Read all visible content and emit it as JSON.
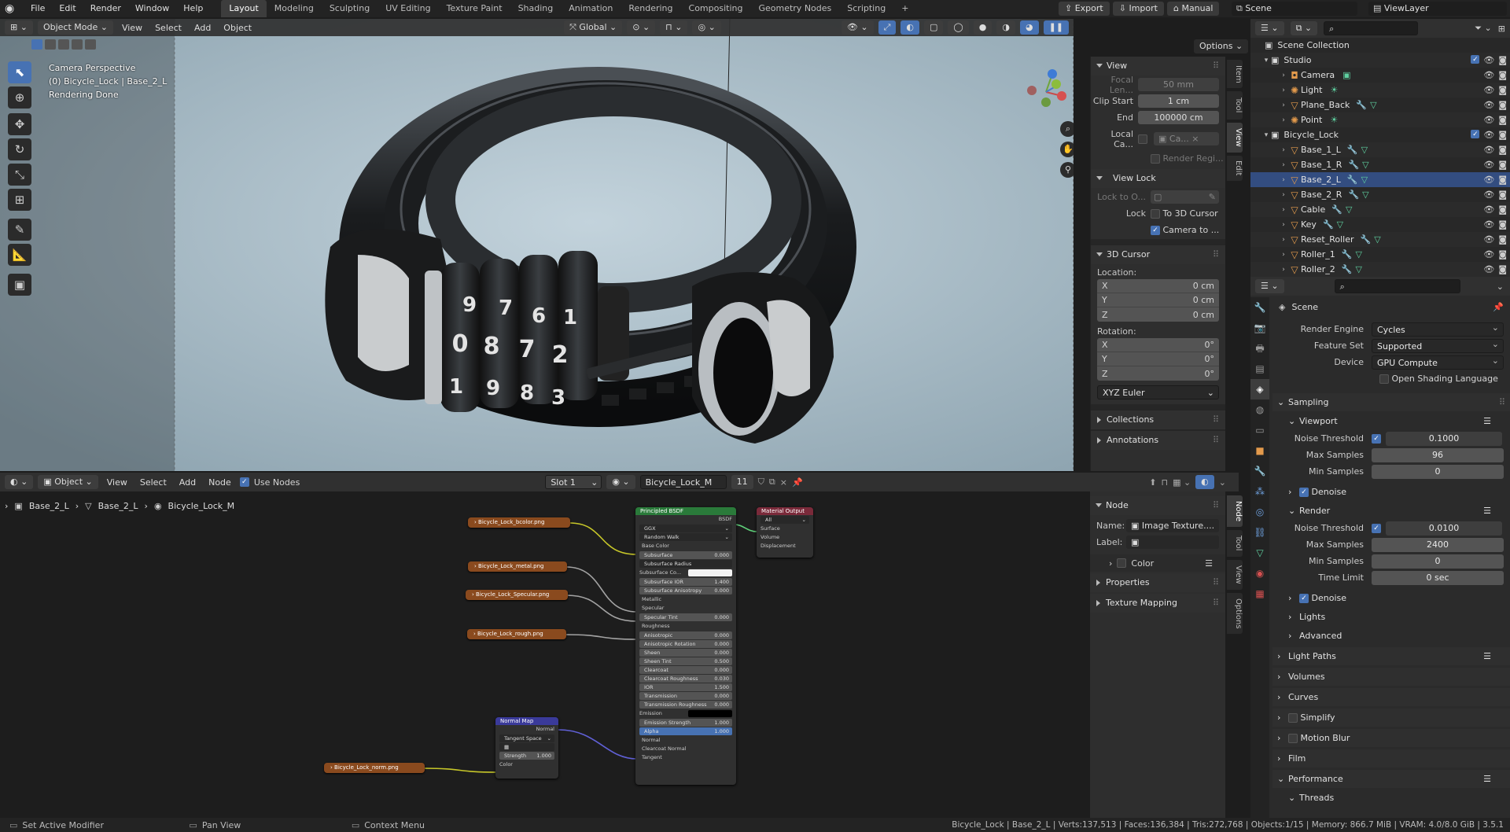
{
  "topbar": {
    "menus": [
      "File",
      "Edit",
      "Render",
      "Window",
      "Help"
    ],
    "workspaces": [
      "Layout",
      "Modeling",
      "Sculpting",
      "UV Editing",
      "Texture Paint",
      "Shading",
      "Animation",
      "Rendering",
      "Compositing",
      "Geometry Nodes",
      "Scripting"
    ],
    "active_workspace": "Layout",
    "add_tab": "+",
    "export_label": "Export",
    "import_label": "Import",
    "manual_label": "Manual",
    "scene_name": "Scene",
    "viewlayer_name": "ViewLayer"
  },
  "viewport": {
    "mode": "Object Mode",
    "menus": [
      "View",
      "Select",
      "Add",
      "Object"
    ],
    "transform_orientation": "Global",
    "options_label": "Options",
    "overlay_lines": [
      "Camera Perspective",
      "(0) Bicycle_Lock | Base_2_L",
      "Rendering Done"
    ],
    "dial_digits": [
      "9",
      "7",
      "6",
      "1",
      "0",
      "8",
      "7",
      "2",
      "1",
      "9",
      "8",
      "3"
    ]
  },
  "npanel": {
    "tabs": [
      "Item",
      "Tool",
      "View",
      "Edit"
    ],
    "active_tab": "View",
    "view_title": "View",
    "focal_label": "Focal Len...",
    "focal_value": "50 mm",
    "clip_start_label": "Clip Start",
    "clip_start_value": "1 cm",
    "end_label": "End",
    "end_value": "100000 cm",
    "local_camera_label": "Local Ca...",
    "local_camera_value": "Ca...",
    "render_region_label": "Render Regi...",
    "view_lock_title": "View Lock",
    "lock_to_label": "Lock to O...",
    "lock_label": "Lock",
    "to_3d_cursor": "To 3D Cursor",
    "camera_to": "Camera to ...",
    "cursor_title": "3D Cursor",
    "location_label": "Location:",
    "rotation_label": "Rotation:",
    "loc": [
      {
        "axis": "X",
        "value": "0 cm"
      },
      {
        "axis": "Y",
        "value": "0 cm"
      },
      {
        "axis": "Z",
        "value": "0 cm"
      }
    ],
    "rot": [
      {
        "axis": "X",
        "value": "0°"
      },
      {
        "axis": "Y",
        "value": "0°"
      },
      {
        "axis": "Z",
        "value": "0°"
      }
    ],
    "rotation_mode": "XYZ Euler",
    "collections_title": "Collections",
    "annotations_title": "Annotations"
  },
  "outliner": {
    "root": "Scene Collection",
    "studio": "Studio",
    "studio_items": [
      "Camera",
      "Light",
      "Plane_Back",
      "Point"
    ],
    "lock_collection": "Bicycle_Lock",
    "lock_items": [
      "Base_1_L",
      "Base_1_R",
      "Base_2_L",
      "Base_2_R",
      "Cable",
      "Key",
      "Reset_Roller",
      "Roller_1",
      "Roller_2"
    ],
    "selected": "Base_2_L"
  },
  "properties": {
    "context": "Scene",
    "render_engine_label": "Render Engine",
    "render_engine": "Cycles",
    "feature_set_label": "Feature Set",
    "feature_set": "Supported",
    "device_label": "Device",
    "device": "GPU Compute",
    "osl_label": "Open Shading Language",
    "sampling": "Sampling",
    "viewport": "Viewport",
    "noise_threshold_label": "Noise Threshold",
    "vp_noise": "0.1000",
    "max_samples_label": "Max Samples",
    "vp_max": "96",
    "min_samples_label": "Min Samples",
    "vp_min": "0",
    "denoise": "Denoise",
    "render": "Render",
    "r_noise": "0.0100",
    "r_max": "2400",
    "r_min": "0",
    "time_limit_label": "Time Limit",
    "r_time": "0 sec",
    "sections": [
      "Lights",
      "Advanced"
    ],
    "lower_sections": [
      "Light Paths",
      "Volumes",
      "Curves",
      "Simplify",
      "Motion Blur",
      "Film",
      "Performance"
    ],
    "threads": "Threads"
  },
  "node_editor": {
    "editor_type": "Object",
    "menus": [
      "View",
      "Select",
      "Add",
      "Node"
    ],
    "use_nodes": "Use Nodes",
    "slot": "Slot 1",
    "material": "Bicycle_Lock_M",
    "users": "11",
    "breadcrumb": [
      "Base_2_L",
      "Base_2_L",
      "Bicycle_Lock_M"
    ],
    "images": [
      "Bicycle_Lock_bcolor.png",
      "Bicycle_Lock_metal.png",
      "Bicycle_Lock_Specular.png",
      "Bicycle_Lock_rough.png",
      "Bicycle_Lock_norm.png"
    ],
    "bsdf_title": "Principled BSDF",
    "bsdf_out": "BSDF",
    "distribution": "GGX",
    "sss_method": "Random Walk",
    "bsdf_rows": [
      {
        "k": "Base Color",
        "t": "sock"
      },
      {
        "k": "Subsurface",
        "t": "field",
        "v": "0.000"
      },
      {
        "k": "Subsurface Radius",
        "t": "drop"
      },
      {
        "k": "Subsurface Co...",
        "t": "color"
      },
      {
        "k": "Subsurface IOR",
        "t": "field",
        "v": "1.400"
      },
      {
        "k": "Subsurface Anisotropy",
        "t": "field",
        "v": "0.000"
      },
      {
        "k": "Metallic",
        "t": "sock"
      },
      {
        "k": "Specular",
        "t": "sock"
      },
      {
        "k": "Specular Tint",
        "t": "field",
        "v": "0.000"
      },
      {
        "k": "Roughness",
        "t": "sock"
      },
      {
        "k": "Anisotropic",
        "t": "field",
        "v": "0.000"
      },
      {
        "k": "Anisotropic Rotation",
        "t": "field",
        "v": "0.000"
      },
      {
        "k": "Sheen",
        "t": "field",
        "v": "0.000"
      },
      {
        "k": "Sheen Tint",
        "t": "field",
        "v": "0.500"
      },
      {
        "k": "Clearcoat",
        "t": "field",
        "v": "0.000"
      },
      {
        "k": "Clearcoat Roughness",
        "t": "field",
        "v": "0.030"
      },
      {
        "k": "IOR",
        "t": "field",
        "v": "1.500"
      },
      {
        "k": "Transmission",
        "t": "field",
        "v": "0.000"
      },
      {
        "k": "Transmission Roughness",
        "t": "field",
        "v": "0.000"
      },
      {
        "k": "Emission",
        "t": "emis"
      },
      {
        "k": "Emission Strength",
        "t": "field",
        "v": "1.000"
      },
      {
        "k": "Alpha",
        "t": "alpha",
        "v": "1.000"
      },
      {
        "k": "Normal",
        "t": "sock"
      },
      {
        "k": "Clearcoat Normal",
        "t": "sock"
      },
      {
        "k": "Tangent",
        "t": "sock"
      }
    ],
    "output_title": "Material Output",
    "output_target": "All",
    "output_sockets": [
      "Surface",
      "Volume",
      "Displacement"
    ],
    "normal_map_title": "Normal Map",
    "normal_out": "Normal",
    "tangent_space": "Tangent Space",
    "strength_label": "Strength",
    "strength_value": "1.000",
    "color_in": "Color"
  },
  "node_side": {
    "tabs": [
      "Node",
      "Tool",
      "View",
      "Options"
    ],
    "node_title": "Node",
    "name_label": "Name:",
    "name_value": "Image Texture....",
    "label_label": "Label:",
    "color": "Color",
    "properties": "Properties",
    "texture_mapping": "Texture Mapping"
  },
  "statusbar": {
    "left": [
      "Set Active Modifier",
      "Pan View",
      "Context Menu"
    ],
    "right": "Bicycle_Lock | Base_2_L | Verts:137,513 | Faces:136,384 | Tris:272,768 | Objects:1/15 | Memory: 866.7 MiB | VRAM: 4.0/8.0 GiB | 3.5.1"
  },
  "colors": {
    "accent": "#4772b3",
    "selected_row": "#334d80",
    "image_node": "#8a4a1e",
    "bsdf_header": "#2a7a3a",
    "output_header": "#7a2a3a",
    "normal_header": "#3a3a9a"
  }
}
